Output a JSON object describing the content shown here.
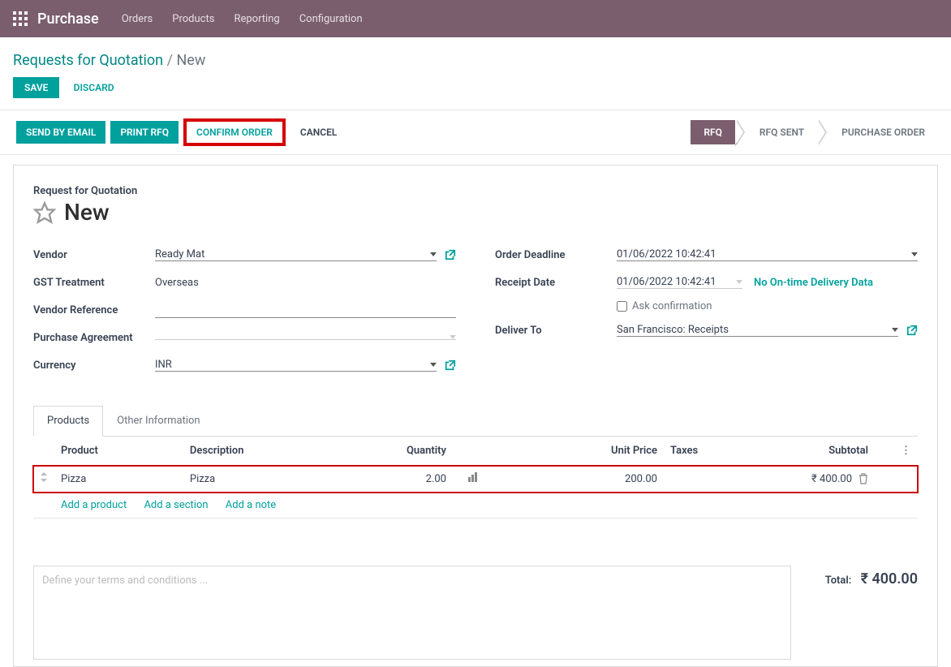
{
  "topbar": {
    "app_title": "Purchase",
    "menu": [
      "Orders",
      "Products",
      "Reporting",
      "Configuration"
    ]
  },
  "breadcrumb": {
    "parent": "Requests for Quotation",
    "sep": "/",
    "current": "New"
  },
  "buttons": {
    "save": "SAVE",
    "discard": "DISCARD",
    "send_email": "SEND BY EMAIL",
    "print_rfq": "PRINT RFQ",
    "confirm_order": "CONFIRM ORDER",
    "cancel": "CANCEL"
  },
  "status": {
    "rfq": "RFQ",
    "rfq_sent": "RFQ SENT",
    "purchase_order": "PURCHASE ORDER"
  },
  "sheet": {
    "subtitle": "Request for Quotation",
    "title": "New"
  },
  "form": {
    "vendor_label": "Vendor",
    "vendor_value": "Ready Mat",
    "gst_label": "GST Treatment",
    "gst_value": "Overseas",
    "vendor_ref_label": "Vendor Reference",
    "vendor_ref_value": "",
    "purchase_agreement_label": "Purchase Agreement",
    "purchase_agreement_value": "",
    "currency_label": "Currency",
    "currency_value": "INR",
    "order_deadline_label": "Order Deadline",
    "order_deadline_value": "01/06/2022 10:42:41",
    "receipt_date_label": "Receipt Date",
    "receipt_date_value": "01/06/2022 10:42:41",
    "no_ontime_link": "No On-time Delivery Data",
    "ask_confirmation_label": "Ask confirmation",
    "deliver_to_label": "Deliver To",
    "deliver_to_value": "San Francisco: Receipts"
  },
  "tabs": {
    "products": "Products",
    "other_info": "Other Information"
  },
  "columns": {
    "product": "Product",
    "description": "Description",
    "quantity": "Quantity",
    "unit_price": "Unit Price",
    "taxes": "Taxes",
    "subtotal": "Subtotal"
  },
  "lines": [
    {
      "product": "Pizza",
      "description": "Pizza",
      "quantity": "2.00",
      "unit_price": "200.00",
      "taxes": "",
      "subtotal": "₹ 400.00"
    }
  ],
  "addrow": {
    "add_product": "Add a product",
    "add_section": "Add a section",
    "add_note": "Add a note"
  },
  "terms_placeholder": "Define your terms and conditions ...",
  "total_label": "Total:",
  "total_value": "₹ 400.00"
}
